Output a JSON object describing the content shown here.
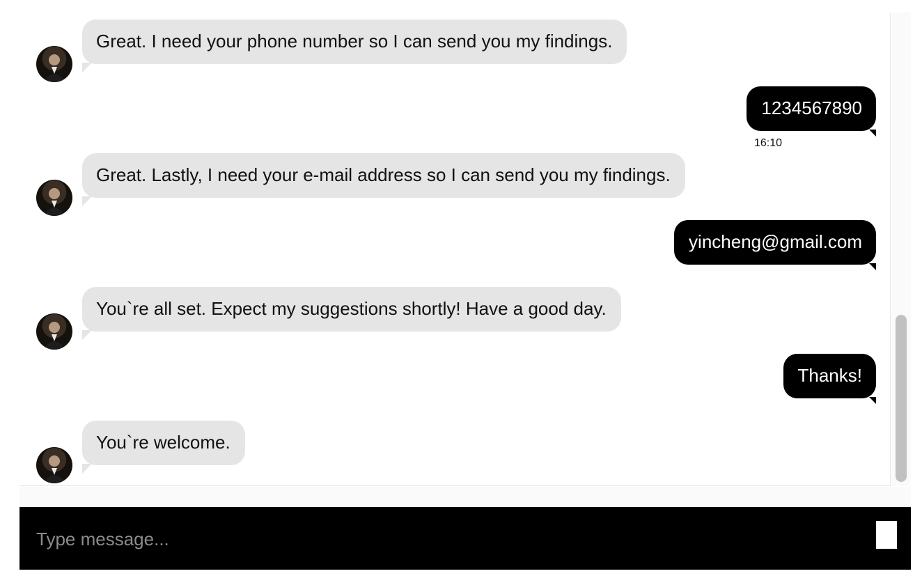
{
  "conversation": {
    "messages": [
      {
        "sender": "bot",
        "text": "Great. I need your phone number so I can send you my findings."
      },
      {
        "sender": "user",
        "text": "1234567890",
        "time": "16:10"
      },
      {
        "sender": "bot",
        "text": "Great. Lastly, I need your e-mail address so I can send you my findings."
      },
      {
        "sender": "user",
        "text": "yincheng@gmail.com"
      },
      {
        "sender": "bot",
        "text": "You`re all set. Expect my suggestions shortly! Have a good day."
      },
      {
        "sender": "user",
        "text": "Thanks!"
      },
      {
        "sender": "bot",
        "text": "You`re welcome."
      }
    ]
  },
  "composer": {
    "placeholder": "Type message...",
    "value": ""
  },
  "colors": {
    "bot_bubble": "#e5e5e5",
    "user_bubble": "#000000",
    "input_bar": "#000000"
  },
  "icons": {
    "avatar": "bot-avatar-photo",
    "send": "send-icon"
  }
}
